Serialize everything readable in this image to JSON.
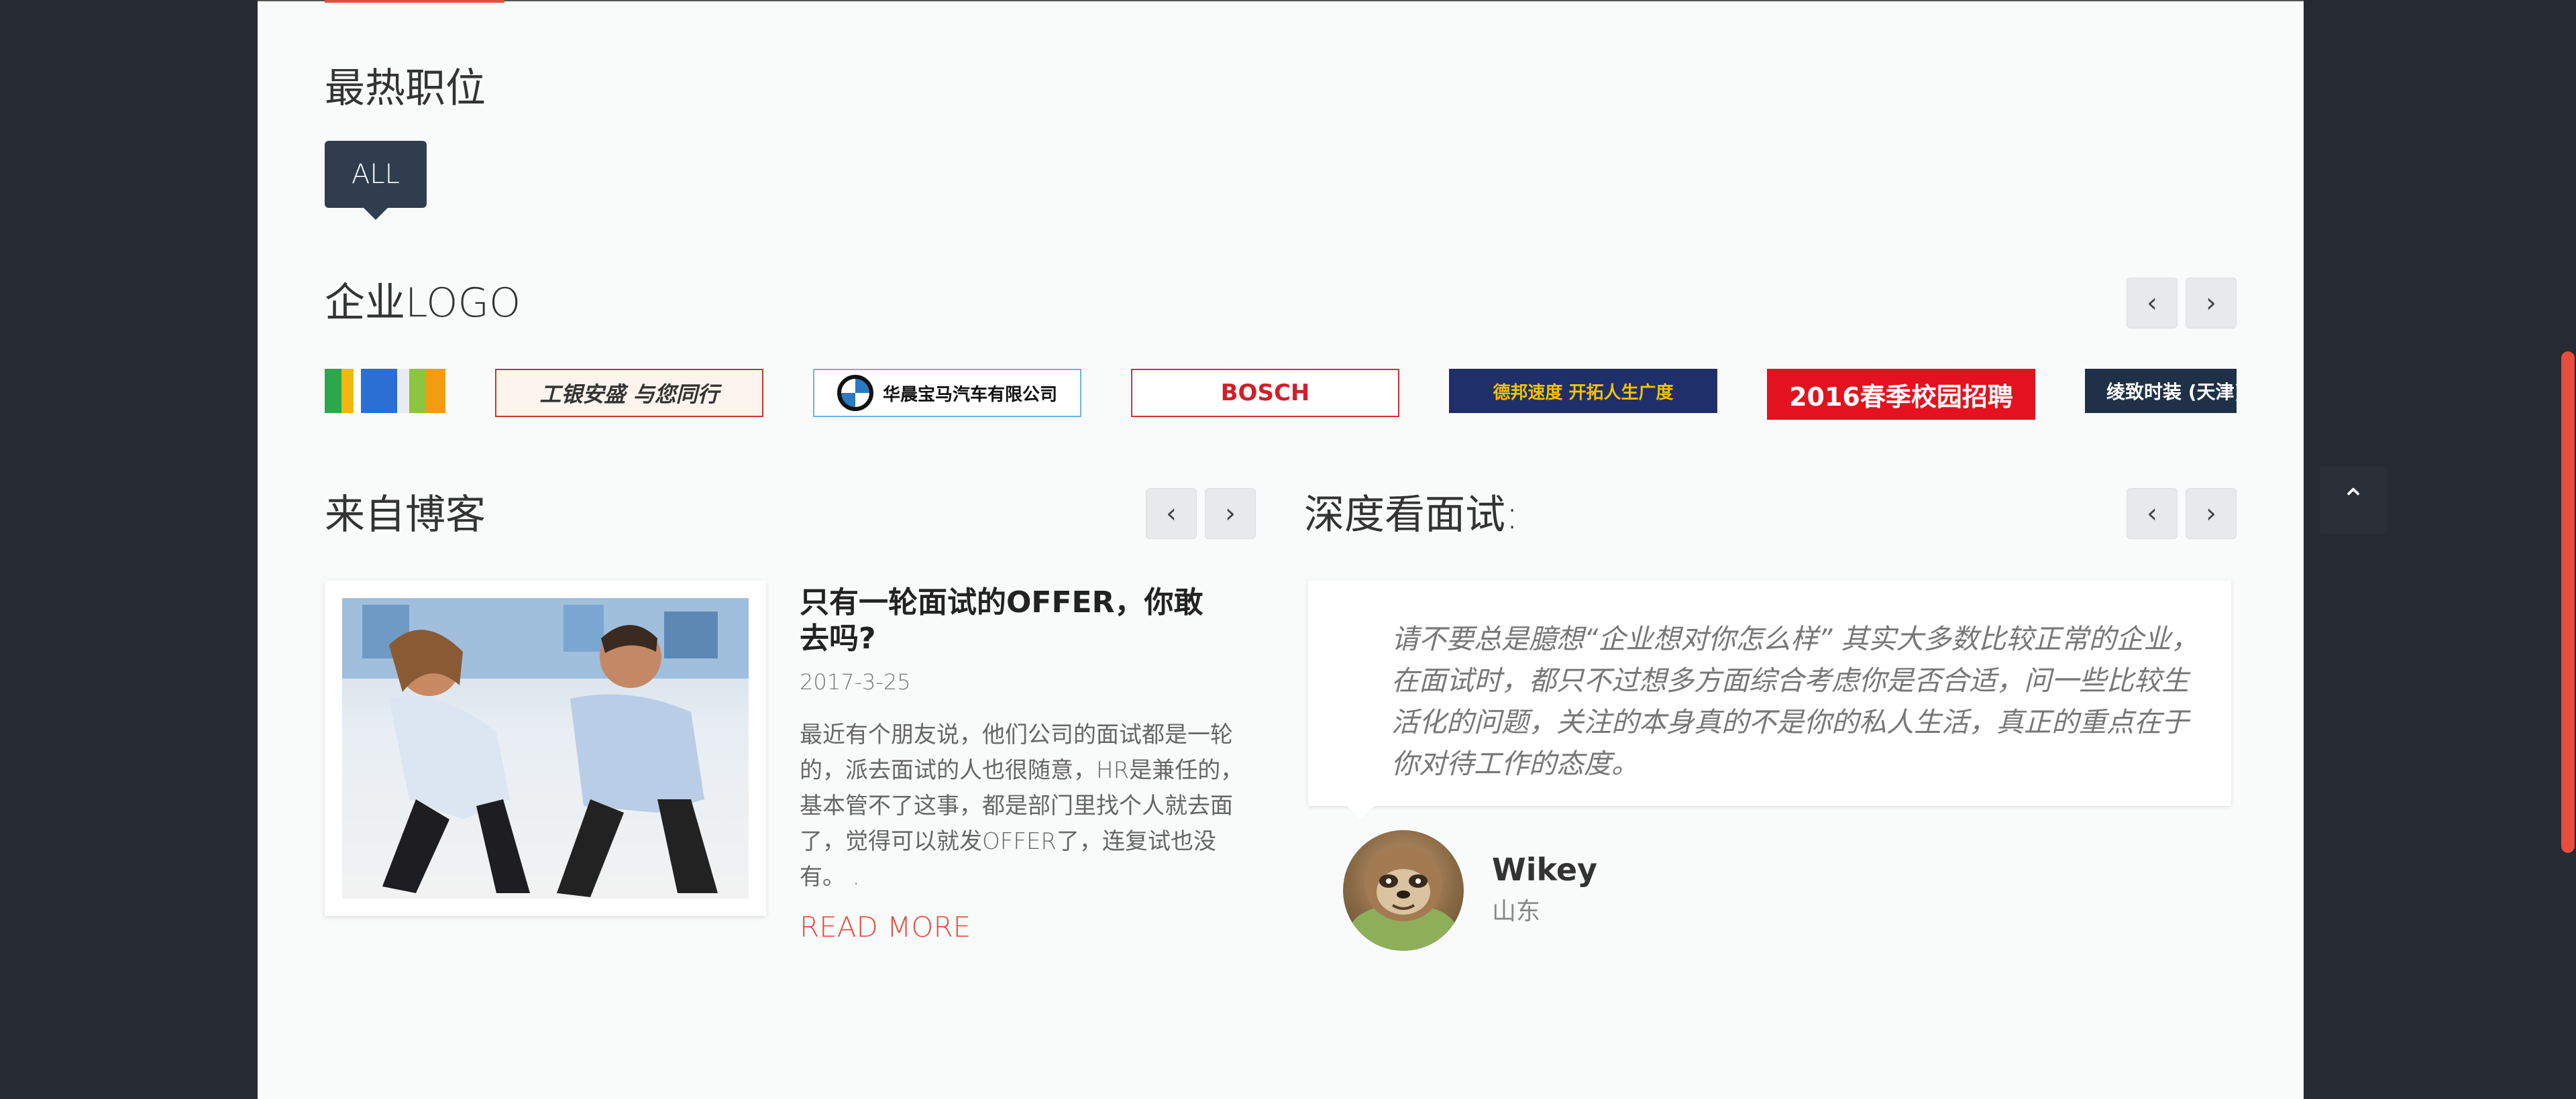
{
  "sections": {
    "hot_jobs": {
      "title": "最热职位",
      "filter_label": "ALL"
    },
    "logos": {
      "title": "企业LOGO",
      "prev": "‹",
      "next": "›",
      "items": [
        {
          "text": "",
          "name": "logo-colorful"
        },
        {
          "text": "工银安盛 与您同行",
          "name": "logo-gongyin"
        },
        {
          "text": "华晨宝马汽车有限公司",
          "name": "logo-bmw"
        },
        {
          "text": "BOSCH",
          "name": "logo-bosch"
        },
        {
          "text": "德邦速度 开拓人生广度",
          "name": "logo-debang"
        },
        {
          "text": "2016春季校园招聘",
          "name": "logo-campus"
        },
        {
          "text": "绫致时装 (天津)",
          "name": "logo-bestseller"
        }
      ]
    },
    "blog": {
      "title": "来自博客",
      "prev": "‹",
      "next": "›",
      "post_title": "只有一轮面试的OFFER，你敢去吗?",
      "date": "2017-3-25",
      "excerpt": "最近有个朋友说，他们公司的面试都是一轮的，派去面试的人也很随意，HR是兼任的，基本管不了这事，都是部门里找个人就去面了，觉得可以就发OFFER了，连复试也没有。 .",
      "read_more": "READ MORE"
    },
    "interview": {
      "title": "深度看面试:",
      "prev": "‹",
      "next": "›",
      "quote": "请不要总是臆想“企业想对你怎么样” 其实大多数比较正常的企业，在面试时，都只不过想多方面综合考虑你是否合适，问一些比较生活化的问题，关注的本身真的不是你的私人生活，真正的重点在于你对待工作的态度。",
      "author": "Wikey",
      "location": "山东"
    }
  },
  "controls": {
    "scroll_top": "⌃"
  },
  "colors": {
    "accent": "#e74c3c",
    "dark_button": "#2f3d4f",
    "background": "#252a33",
    "panel": "#f9fafa"
  }
}
